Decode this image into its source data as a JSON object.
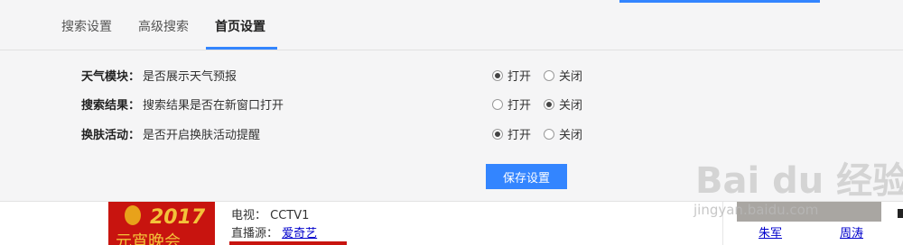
{
  "tabs": [
    {
      "label": "搜索设置"
    },
    {
      "label": "高级搜索"
    },
    {
      "label": "首页设置"
    }
  ],
  "settings": [
    {
      "label": "天气模块：",
      "desc": "是否展示天气预报",
      "on_label": "打开",
      "off_label": "关闭",
      "selected": "on"
    },
    {
      "label": "搜索结果：",
      "desc": "搜索结果是否在新窗口打开",
      "on_label": "打开",
      "off_label": "关闭",
      "selected": "off"
    },
    {
      "label": "换肤活动：",
      "desc": "是否开启换肤活动提醒",
      "on_label": "打开",
      "off_label": "关闭",
      "selected": "on"
    }
  ],
  "save_label": "保存设置",
  "poster": {
    "year": "2017",
    "title": "元宵晚会"
  },
  "info": {
    "tv_label": "电视：",
    "tv_value": "CCTV1",
    "source_label": "直播源：",
    "source_value": "爱奇艺"
  },
  "people": [
    "朱军",
    "周涛"
  ],
  "watermark": {
    "main": "Bai du 经验",
    "sub": "jingyan.baidu.com"
  },
  "colors": {
    "accent": "#3385ff",
    "panel_bg": "#f5f5f6",
    "link": "#0000cc",
    "poster_red": "#c8140f"
  }
}
